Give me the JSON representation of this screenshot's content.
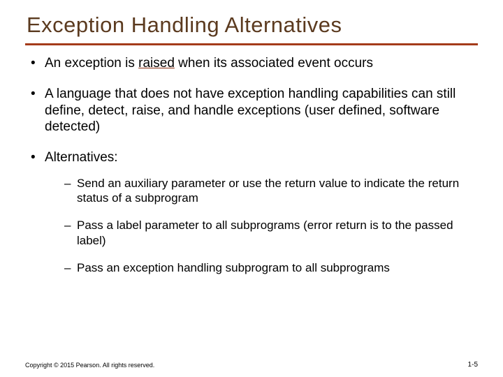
{
  "title": "Exception Handling Alternatives",
  "bullets": [
    {
      "pre": "An exception is ",
      "u": "raised",
      "post": " when its associated event occurs"
    },
    {
      "text": "A language that does not have exception handling capabilities can still define, detect, raise, and handle exceptions (user defined, software detected)"
    },
    {
      "text": "Alternatives:",
      "sub": [
        "Send an auxiliary parameter or use the return value to indicate the return status of a subprogram",
        "Pass a label parameter to all subprograms (error return is to the passed label)",
        "Pass an exception handling subprogram to all subprograms"
      ]
    }
  ],
  "footer": "Copyright © 2015 Pearson. All rights reserved.",
  "pagenum": "1-5"
}
